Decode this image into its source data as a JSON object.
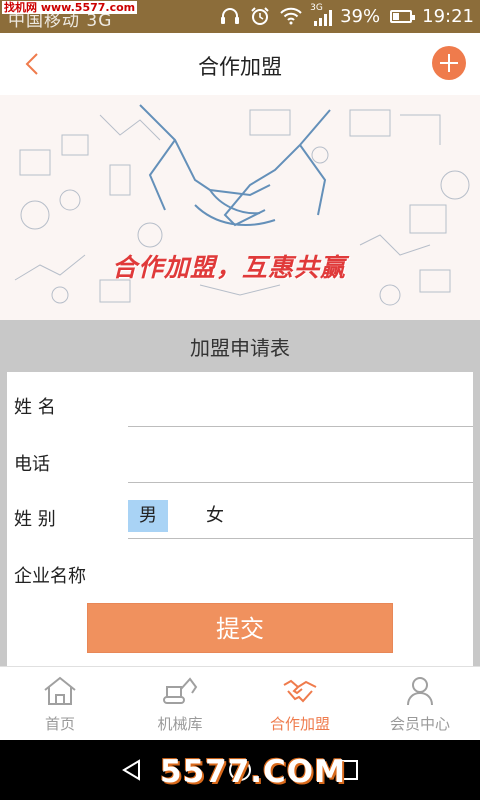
{
  "status_bar": {
    "carrier": "中国移动 3G",
    "watermark": "找机网 www.5577.com",
    "network": "3G",
    "battery": "39%",
    "battery_level": 0.39,
    "time": "19:21"
  },
  "nav": {
    "title": "合作加盟",
    "back_icon": "chevron-left-icon",
    "add_icon": "plus-circle-icon"
  },
  "banner": {
    "slogan": "合作加盟，互惠共赢"
  },
  "form": {
    "title": "加盟申请表",
    "name_label": "姓  名",
    "phone_label": "电话",
    "gender_label": "姓  别",
    "gender_options": [
      "男",
      "女"
    ],
    "gender_selected": "男",
    "company_label": "企业名称",
    "submit_label": "提交"
  },
  "tabs": [
    {
      "label": "首页",
      "icon": "home-icon",
      "active": false
    },
    {
      "label": "机械库",
      "icon": "excavator-icon",
      "active": false
    },
    {
      "label": "合作加盟",
      "icon": "handshake-icon",
      "active": true
    },
    {
      "label": "会员中心",
      "icon": "user-icon",
      "active": false
    }
  ],
  "system_nav": {
    "watermark": "5577.COM"
  },
  "colors": {
    "accent": "#ef7b4c",
    "status_bar": "#8c6d3a",
    "selected_option": "#a9d3f5",
    "submit_button": "#f0915e"
  }
}
